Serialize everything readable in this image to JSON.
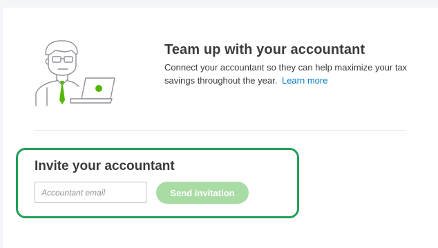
{
  "hero": {
    "title": "Team up with your accountant",
    "description": "Connect your accountant so they can help maximize your tax savings throughout the year.",
    "learn_more": "Learn more"
  },
  "invite": {
    "title": "Invite your accountant",
    "email_placeholder": "Accountant email",
    "email_value": "",
    "send_label": "Send invitation"
  },
  "colors": {
    "accent_green": "#1fa055",
    "tie_green": "#53b700",
    "button_disabled": "#a9dca4",
    "link": "#0077c5",
    "text": "#393a3d"
  }
}
